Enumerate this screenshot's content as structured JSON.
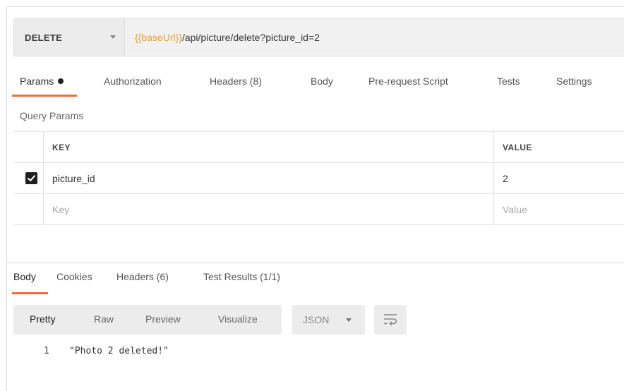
{
  "request": {
    "method": "DELETE",
    "url_variable": "{{baseUrl}}",
    "url_path": "/api/picture/delete?picture_id=2"
  },
  "request_tabs": [
    {
      "label": "Params",
      "active": true,
      "indicator": "dot"
    },
    {
      "label": "Authorization"
    },
    {
      "label": "Headers (8)"
    },
    {
      "label": "Body"
    },
    {
      "label": "Pre-request Script"
    },
    {
      "label": "Tests"
    },
    {
      "label": "Settings"
    }
  ],
  "params": {
    "section_label": "Query Params",
    "columns": {
      "key": "KEY",
      "value": "VALUE"
    },
    "rows": [
      {
        "checked": true,
        "key": "picture_id",
        "value": "2"
      }
    ],
    "new_row": {
      "key_placeholder": "Key",
      "value_placeholder": "Value"
    }
  },
  "response_tabs": [
    {
      "label": "Body",
      "active": true
    },
    {
      "label": "Cookies"
    },
    {
      "label": "Headers (6)"
    },
    {
      "label": "Test Results (1/1)"
    }
  ],
  "format": {
    "options": [
      "Pretty",
      "Raw",
      "Preview",
      "Visualize"
    ],
    "selected": "Pretty",
    "language": "JSON",
    "wrap_icon": "wrap-lines-icon"
  },
  "response_body": {
    "lines": [
      {
        "number": "1",
        "text": "\"Photo 2 deleted!\""
      }
    ]
  },
  "colors": {
    "accent": "#f26b3a",
    "variable": "#e6a23c",
    "checkbox": "#1f1f1f"
  }
}
